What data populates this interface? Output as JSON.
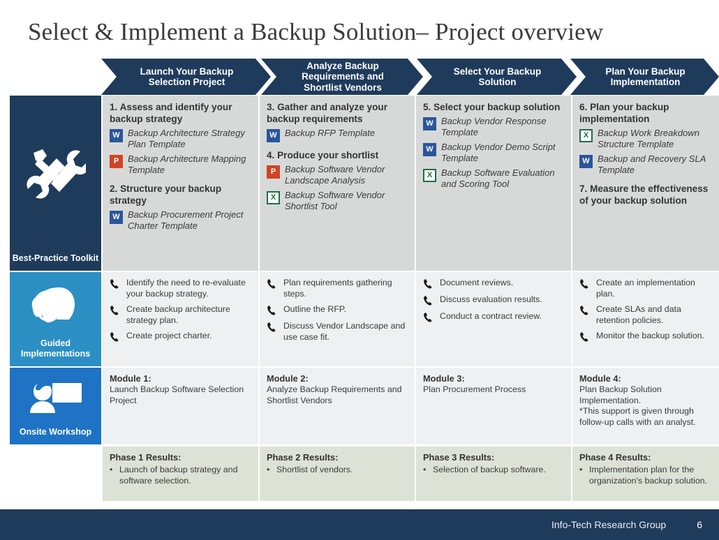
{
  "slide": {
    "title": "Select & Implement a Backup Solution– Project overview"
  },
  "colors": {
    "navy": "#1f3b5c",
    "light_blue": "#2b8fc4",
    "bright_blue": "#1e73c4",
    "toolkit_bg": "#d7d9d9",
    "gi_bg": "#eef0f2",
    "module_bg": "#eef1f3",
    "results_bg": "#dde2d6"
  },
  "phases": [
    {
      "label": "Launch Your Backup Selection Project"
    },
    {
      "label": "Analyze Backup Requirements and Shortlist Vendors"
    },
    {
      "label": "Select Your Backup Solution"
    },
    {
      "label": "Plan Your Backup Implementation"
    }
  ],
  "rail": [
    {
      "label": "Best-Practice Toolkit",
      "icon": "tools-icon"
    },
    {
      "label": "Guided Implementations",
      "icon": "headset-profile-icon"
    },
    {
      "label": "Onsite Workshop",
      "icon": "presenter-whiteboard-icon"
    }
  ],
  "toolkit": [
    {
      "blocks": [
        {
          "type": "heading",
          "text": "1. Assess and identify your backup strategy"
        },
        {
          "type": "doc",
          "file": "word",
          "text": "Backup Architecture Strategy Plan Template"
        },
        {
          "type": "doc",
          "file": "ppt",
          "text": "Backup Architecture Mapping Template"
        },
        {
          "type": "heading",
          "text": "2. Structure your backup strategy"
        },
        {
          "type": "doc",
          "file": "word",
          "text": "Backup Procurement Project Charter Template"
        }
      ]
    },
    {
      "blocks": [
        {
          "type": "heading",
          "text": "3. Gather and analyze your backup requirements"
        },
        {
          "type": "doc",
          "file": "word",
          "text": "Backup RFP Template"
        },
        {
          "type": "heading",
          "text": "4. Produce your shortlist"
        },
        {
          "type": "doc",
          "file": "ppt",
          "text": "Backup Software Vendor Landscape Analysis"
        },
        {
          "type": "doc",
          "file": "xls",
          "text": "Backup Software Vendor Shortlist Tool"
        }
      ]
    },
    {
      "blocks": [
        {
          "type": "heading",
          "text": "5. Select your backup solution"
        },
        {
          "type": "doc",
          "file": "word",
          "text": "Backup Vendor Response Template"
        },
        {
          "type": "doc",
          "file": "word",
          "text": "Backup Vendor Demo Script Template"
        },
        {
          "type": "doc",
          "file": "xls",
          "text": "Backup Software Evaluation and Scoring Tool"
        }
      ]
    },
    {
      "blocks": [
        {
          "type": "heading",
          "text": "6. Plan your backup implementation"
        },
        {
          "type": "doc",
          "file": "xls",
          "text": "Backup Work Breakdown Structure Template"
        },
        {
          "type": "doc",
          "file": "word",
          "text": "Backup and Recovery SLA Template"
        },
        {
          "type": "heading",
          "text": "7. Measure the effectiveness of your backup solution"
        }
      ]
    }
  ],
  "guided": [
    {
      "items": [
        "Identify the need to re-evaluate your backup strategy.",
        "Create backup architecture strategy plan.",
        "Create project charter."
      ]
    },
    {
      "items": [
        "Plan requirements gathering steps.",
        "Outline the RFP.",
        "Discuss Vendor Landscape and use case fit."
      ]
    },
    {
      "items": [
        "Document reviews.",
        "Discuss evaluation results.",
        "Conduct a contract review."
      ]
    },
    {
      "items": [
        "Create an implementation plan.",
        "Create SLAs and data retention policies.",
        "Monitor the backup solution."
      ]
    }
  ],
  "workshop": [
    {
      "title": "Module 1:",
      "body": "Launch Backup Software Selection Project"
    },
    {
      "title": "Module 2:",
      "body": "Analyze Backup Requirements and Shortlist Vendors"
    },
    {
      "title": "Module 3:",
      "body": "Plan Procurement Process"
    },
    {
      "title": "Module 4:",
      "body": "Plan Backup Solution Implementation.\n*This support is given through follow-up calls with an analyst."
    }
  ],
  "results": [
    {
      "title": "Phase 1 Results:",
      "bullet": "•",
      "text": "Launch of backup strategy and software selection."
    },
    {
      "title": "Phase 2 Results:",
      "bullet": "•",
      "text": "Shortlist of vendors."
    },
    {
      "title": "Phase 3 Results:",
      "bullet": "•",
      "text": "Selection of backup software."
    },
    {
      "title": "Phase 4 Results:",
      "bullet": "•",
      "text": "Implementation plan for the organization's backup solution."
    }
  ],
  "footer": {
    "brand": "Info-Tech Research Group",
    "page": "6"
  }
}
